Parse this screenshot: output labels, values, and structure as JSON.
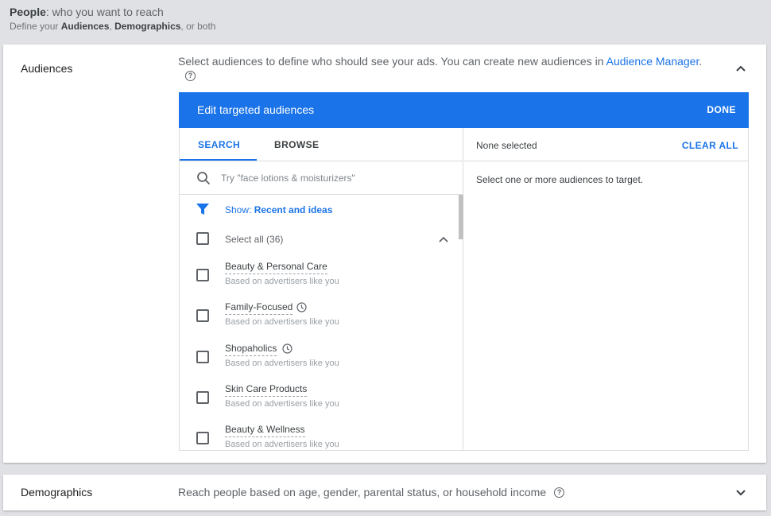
{
  "header": {
    "title_bold": "People",
    "title_rest": ": who you want to reach",
    "subtitle_pre": "Define your ",
    "subtitle_audiences": "Audiences",
    "subtitle_comma": ", ",
    "subtitle_demographics": "Demographics",
    "subtitle_post": ", or both"
  },
  "audiences": {
    "title": "Audiences",
    "description": "Select audiences to define who should see your ads.  You can create new audiences in ",
    "link": "Audience Manager",
    "description_end": ".",
    "help_icon": "?",
    "editor": {
      "title": "Edit targeted audiences",
      "done": "DONE",
      "tabs": [
        {
          "label": "SEARCH",
          "active": true
        },
        {
          "label": "BROWSE",
          "active": false
        }
      ],
      "search_placeholder": "Try \"face lotions & moisturizers\"",
      "filter_prefix": "Show: ",
      "filter_value": "Recent and ideas",
      "select_all": "Select all (36)",
      "items": [
        {
          "title": "Beauty & Personal Care",
          "subtitle": "Based on advertisers like you",
          "clock": false
        },
        {
          "title": "Family-Focused",
          "subtitle": "Based on advertisers like you",
          "clock": true
        },
        {
          "title": "Shopaholics",
          "subtitle": "Based on advertisers like you",
          "clock": true
        },
        {
          "title": "Skin Care Products",
          "subtitle": "Based on advertisers like you",
          "clock": false
        },
        {
          "title": "Beauty & Wellness",
          "subtitle": "Based on advertisers like you",
          "clock": false
        }
      ],
      "right_pane": {
        "none_selected": "None selected",
        "clear_all": "CLEAR ALL",
        "hint": "Select one or more audiences to target."
      }
    }
  },
  "demographics": {
    "title": "Demographics",
    "description": "Reach people based on age, gender, parental status, or household income",
    "help_icon": "?"
  },
  "colors": {
    "accent": "#1a73e8",
    "background": "#e0e1e5",
    "text": "#3c4043"
  }
}
